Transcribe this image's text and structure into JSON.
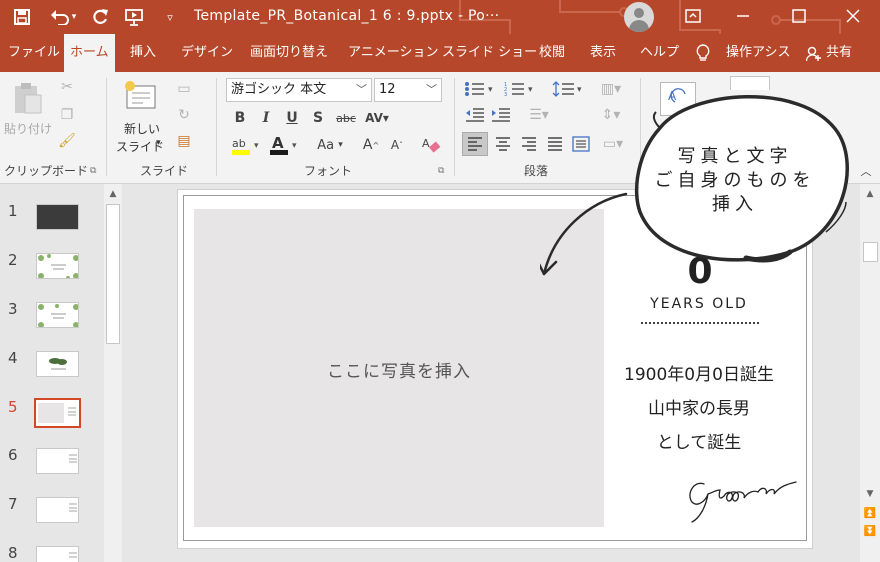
{
  "titlebar": {
    "title": "Template_PR_Botanical_1 6 : 9.pptx  -  Po···",
    "save_icon": "save-icon",
    "undo_icon": "undo-icon",
    "redo_icon": "redo-icon",
    "present_icon": "present-from-start-icon",
    "customize_icon": "customize-qat-icon",
    "brand_color": "#b7472a"
  },
  "tabs": [
    {
      "label": "ファイル"
    },
    {
      "label": "ホーム"
    },
    {
      "label": "挿入"
    },
    {
      "label": "デザイン"
    },
    {
      "label": "画面切り替え"
    },
    {
      "label": "アニメーション"
    },
    {
      "label": "スライド ショー"
    },
    {
      "label": "校閲"
    },
    {
      "label": "表示"
    },
    {
      "label": "ヘルプ"
    },
    {
      "label": "操作アシス"
    },
    {
      "label": "共有"
    }
  ],
  "ribbon": {
    "clipboard": {
      "paste": "貼り付け",
      "label": "クリップボード"
    },
    "slides": {
      "new_slide_line1": "新しい",
      "new_slide_line2": "スライド",
      "label": "スライド"
    },
    "font": {
      "name": "游ゴシック 本文",
      "size": "12",
      "label": "フォント",
      "aa": "Aa"
    },
    "paragraph": {
      "label": "段落"
    }
  },
  "thumbnails": [
    "1",
    "2",
    "3",
    "4",
    "5",
    "6",
    "7",
    "8"
  ],
  "selected_slide": "5",
  "slide": {
    "photo_placeholder": "ここに写真を挿入",
    "age": "0",
    "years_old": "YEARS OLD",
    "birth_line1": "1900年0月0日誕生",
    "birth_line2": "山中家の長男",
    "birth_line3": "として誕生",
    "signature": "Groom"
  },
  "callout": {
    "line1": "写真と文字",
    "line2": "ご自身のものを",
    "line3": "挿入"
  }
}
